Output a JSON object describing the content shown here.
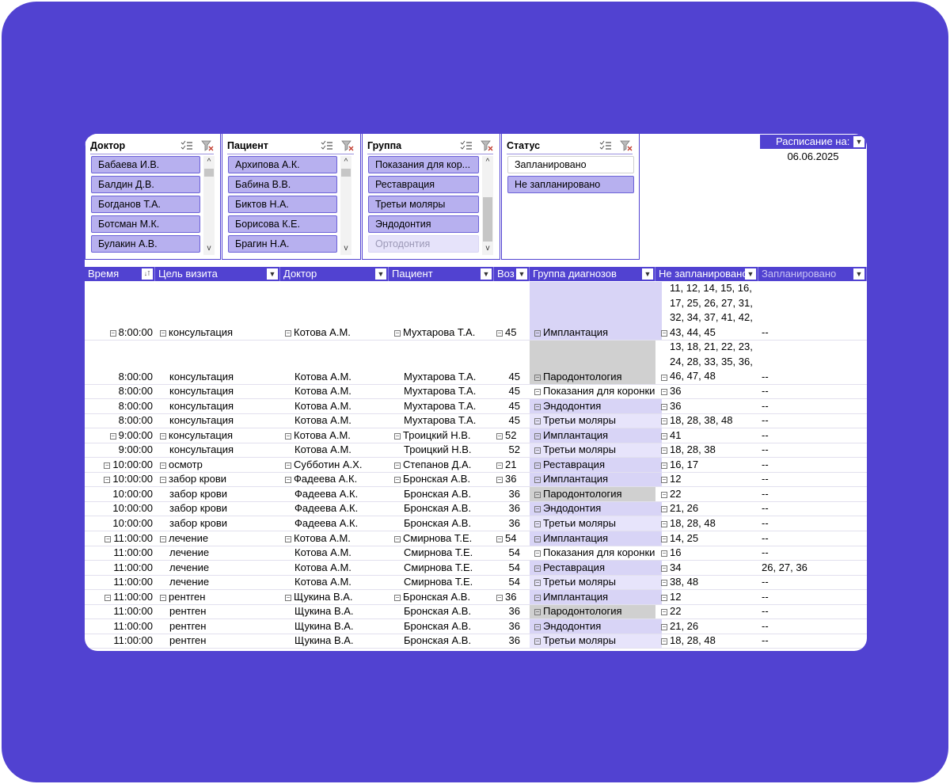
{
  "colors": {
    "frame": "#5142d1",
    "header": "#5142d1",
    "slicer_selected": "#b7b0ef",
    "group_light": "#e7e4fb",
    "group_mid": "#d8d4f6",
    "group_gray": "#d0d0d0"
  },
  "slicers": [
    {
      "title": "Доктор",
      "items": [
        {
          "label": "Бабаева И.В.",
          "state": "on"
        },
        {
          "label": "Балдин  Д.В.",
          "state": "on"
        },
        {
          "label": "Богданов Т.А.",
          "state": "on"
        },
        {
          "label": "Ботсман М.К.",
          "state": "on"
        },
        {
          "label": "Булакин А.В.",
          "state": "on"
        }
      ]
    },
    {
      "title": "Пациент",
      "items": [
        {
          "label": "Архипова А.К.",
          "state": "on"
        },
        {
          "label": "Бабина В.В.",
          "state": "on"
        },
        {
          "label": "Биктов Н.А.",
          "state": "on"
        },
        {
          "label": "Борисова К.Е.",
          "state": "on"
        },
        {
          "label": "Брагин Н.А.",
          "state": "on"
        }
      ]
    },
    {
      "title": "Группа",
      "items": [
        {
          "label": "Показания для кор...",
          "state": "on"
        },
        {
          "label": "Реставрация",
          "state": "on"
        },
        {
          "label": "Третьи моляры",
          "state": "on"
        },
        {
          "label": "Эндодонтия",
          "state": "on"
        },
        {
          "label": "Ортодонтия",
          "state": "dim"
        }
      ]
    },
    {
      "title": "Статус",
      "items": [
        {
          "label": "Запланировано",
          "state": "off"
        },
        {
          "label": "Не запланировано",
          "state": "on"
        }
      ]
    }
  ],
  "schedule": {
    "label": "Расписание на:",
    "date": "06.06.2025"
  },
  "columns": [
    "Время",
    "Цель визита",
    "Доктор",
    "Пациент",
    "Воз",
    "Группа диагнозов",
    "Не запланировано",
    "Запланировано"
  ],
  "rows": [
    {
      "time": "8:00:00",
      "purpose": "консультация",
      "doctor": "Котова А.М.",
      "patient": "Мухтарова Т.А.",
      "age": "45",
      "group": "Имплантация",
      "unplanned": "11, 12, 14, 15, 16, 17, 25, 26, 27, 31, 32, 34, 37, 41, 42, 43, 44, 45",
      "planned": "--",
      "head": true,
      "tone": "mid"
    },
    {
      "time": "8:00:00",
      "purpose": "консультация",
      "doctor": "Котова А.М.",
      "patient": "Мухтарова Т.А.",
      "age": "45",
      "group": "Пародонтология",
      "unplanned": "13, 18, 21, 22, 23, 24, 28, 33, 35, 36, 46, 47, 48",
      "planned": "--",
      "head": false,
      "tone": "gray"
    },
    {
      "time": "8:00:00",
      "purpose": "консультация",
      "doctor": "Котова А.М.",
      "patient": "Мухтарова Т.А.",
      "age": "45",
      "group": "Показания для коронки",
      "unplanned": "36",
      "planned": "--",
      "head": false,
      "tone": "none"
    },
    {
      "time": "8:00:00",
      "purpose": "консультация",
      "doctor": "Котова А.М.",
      "patient": "Мухтарова Т.А.",
      "age": "45",
      "group": "Эндодонтия",
      "unplanned": "36",
      "planned": "--",
      "head": false,
      "tone": "mid"
    },
    {
      "time": "8:00:00",
      "purpose": "консультация",
      "doctor": "Котова А.М.",
      "patient": "Мухтарова Т.А.",
      "age": "45",
      "group": "Третьи моляры",
      "unplanned": "18, 28, 38, 48",
      "planned": "--",
      "head": false,
      "tone": "light"
    },
    {
      "time": "9:00:00",
      "purpose": "консультация",
      "doctor": "Котова А.М.",
      "patient": "Троицкий Н.В.",
      "age": "52",
      "group": "Имплантация",
      "unplanned": "41",
      "planned": "--",
      "head": true,
      "tone": "mid"
    },
    {
      "time": "9:00:00",
      "purpose": "консультация",
      "doctor": "Котова А.М.",
      "patient": "Троицкий Н.В.",
      "age": "52",
      "group": "Третьи моляры",
      "unplanned": "18, 28, 38",
      "planned": "--",
      "head": false,
      "tone": "light"
    },
    {
      "time": "10:00:00",
      "purpose": "осмотр",
      "doctor": "Субботин А.Х.",
      "patient": "Степанов Д.А.",
      "age": "21",
      "group": "Реставрация",
      "unplanned": "16, 17",
      "planned": "--",
      "head": true,
      "tone": "mid"
    },
    {
      "time": "10:00:00",
      "purpose": "забор крови",
      "doctor": "Фадеева А.К.",
      "patient": "Бронская А.В.",
      "age": "36",
      "group": "Имплантация",
      "unplanned": "12",
      "planned": "--",
      "head": true,
      "tone": "mid"
    },
    {
      "time": "10:00:00",
      "purpose": "забор крови",
      "doctor": "Фадеева А.К.",
      "patient": "Бронская А.В.",
      "age": "36",
      "group": "Пародонтология",
      "unplanned": "22",
      "planned": "--",
      "head": false,
      "tone": "gray"
    },
    {
      "time": "10:00:00",
      "purpose": "забор крови",
      "doctor": "Фадеева А.К.",
      "patient": "Бронская А.В.",
      "age": "36",
      "group": "Эндодонтия",
      "unplanned": "21, 26",
      "planned": "--",
      "head": false,
      "tone": "mid"
    },
    {
      "time": "10:00:00",
      "purpose": "забор крови",
      "doctor": "Фадеева А.К.",
      "patient": "Бронская А.В.",
      "age": "36",
      "group": "Третьи моляры",
      "unplanned": "18, 28, 48",
      "planned": "--",
      "head": false,
      "tone": "light"
    },
    {
      "time": "11:00:00",
      "purpose": "лечение",
      "doctor": "Котова А.М.",
      "patient": "Смирнова Т.Е.",
      "age": "54",
      "group": "Имплантация",
      "unplanned": "14, 25",
      "planned": "--",
      "head": true,
      "tone": "mid"
    },
    {
      "time": "11:00:00",
      "purpose": "лечение",
      "doctor": "Котова А.М.",
      "patient": "Смирнова Т.Е.",
      "age": "54",
      "group": "Показания для коронки",
      "unplanned": "16",
      "planned": "--",
      "head": false,
      "tone": "none"
    },
    {
      "time": "11:00:00",
      "purpose": "лечение",
      "doctor": "Котова А.М.",
      "patient": "Смирнова Т.Е.",
      "age": "54",
      "group": "Реставрация",
      "unplanned": "34",
      "planned": "26, 27, 36",
      "head": false,
      "tone": "mid"
    },
    {
      "time": "11:00:00",
      "purpose": "лечение",
      "doctor": "Котова А.М.",
      "patient": "Смирнова Т.Е.",
      "age": "54",
      "group": "Третьи моляры",
      "unplanned": "38, 48",
      "planned": "--",
      "head": false,
      "tone": "light"
    },
    {
      "time": "11:00:00",
      "purpose": "рентген",
      "doctor": "Щукина В.А.",
      "patient": "Бронская А.В.",
      "age": "36",
      "group": "Имплантация",
      "unplanned": "12",
      "planned": "--",
      "head": true,
      "tone": "mid"
    },
    {
      "time": "11:00:00",
      "purpose": "рентген",
      "doctor": "Щукина В.А.",
      "patient": "Бронская А.В.",
      "age": "36",
      "group": "Пародонтология",
      "unplanned": "22",
      "planned": "--",
      "head": false,
      "tone": "gray"
    },
    {
      "time": "11:00:00",
      "purpose": "рентген",
      "doctor": "Щукина В.А.",
      "patient": "Бронская А.В.",
      "age": "36",
      "group": "Эндодонтия",
      "unplanned": "21, 26",
      "planned": "--",
      "head": false,
      "tone": "mid"
    },
    {
      "time": "11:00:00",
      "purpose": "рентген",
      "doctor": "Щукина В.А.",
      "patient": "Бронская А.В.",
      "age": "36",
      "group": "Третьи моляры",
      "unplanned": "18, 28, 48",
      "planned": "--",
      "head": false,
      "tone": "light"
    }
  ]
}
